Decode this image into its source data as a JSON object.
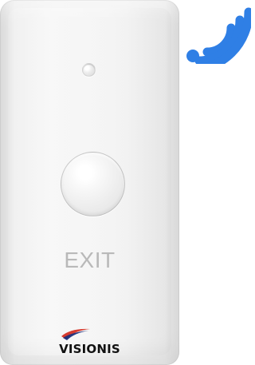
{
  "device": {
    "button_label": "EXIT",
    "brand_name": "VISIONIS"
  },
  "icons": {
    "status_light": "led-indicator-icon",
    "wireless": "wifi-signal-icon",
    "brand_mark": "swoosh-icon"
  },
  "colors": {
    "wireless_blue": "#2f7fe5",
    "panel": "#f2f2f2",
    "label_gray": "#b9b9b9",
    "brand_black": "#111111"
  }
}
